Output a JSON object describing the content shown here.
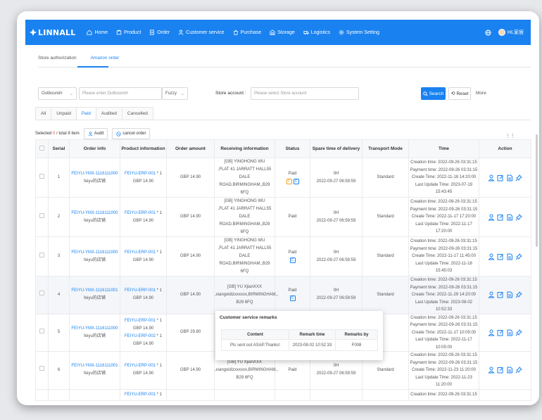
{
  "app": {
    "logo": "LINNALL"
  },
  "nav": [
    {
      "label": "Home",
      "icon": "home-icon"
    },
    {
      "label": "Product",
      "icon": "product-icon"
    },
    {
      "label": "Order",
      "icon": "order-icon"
    },
    {
      "label": "Customer service",
      "icon": "customer-icon"
    },
    {
      "label": "Purchase",
      "icon": "purchase-icon"
    },
    {
      "label": "Storage",
      "icon": "storage-icon"
    },
    {
      "label": "Logistics",
      "icon": "logistics-icon"
    },
    {
      "label": "System Setting",
      "icon": "settings-icon"
    }
  ],
  "user": {
    "name": "HL家居"
  },
  "subtabs": [
    "Store authorization",
    "Amazon order"
  ],
  "filters": {
    "type_select": "Outbound#",
    "keyword_placeholder": "Please enter Outbound#",
    "match_select": "Fuzzy",
    "store_label": "Store account :",
    "store_placeholder": "Please select Store account",
    "search_label": "Search",
    "reset_label": "Reset",
    "more_label": "More"
  },
  "status_tabs": [
    "All",
    "Unpaid",
    "Paid",
    "Audited",
    "Cancelled"
  ],
  "selection": {
    "prefix": "Selected",
    "count": "0",
    "total": "/ total 9 item",
    "audit_label": "Audit",
    "cancel_label": "cancel order"
  },
  "columns": [
    "Serial",
    "Order info",
    "Product information",
    "Order amount",
    "Receiving information",
    "Status",
    "Spare time of delivery",
    "Transport Mode",
    "Time",
    "Action"
  ],
  "rows": [
    {
      "serial": "1",
      "order_id": "FEIYU-YMX-1116111000",
      "store": "feiyu的店铺",
      "products": [
        {
          "sku": "FEIYU-ERP-001",
          "qty": " * 1",
          "price": "GBP 14.90"
        }
      ],
      "amount": "GBP 14.90",
      "recv": [
        "[GB] YINGHONG WU",
        ",FLAT 41 JARRATT HALL55 DALE",
        "ROAD,BIRMINGHAM,,B29 6FQ"
      ],
      "status": "Paid",
      "tags": [
        "F",
        "C"
      ],
      "spare": "0H",
      "spare_date": "2022-09-27 06:59:59",
      "transport": "Standard",
      "times": [
        "Creation time: 2022-09-26 03:31:15",
        "Payment time: 2022-09-26 03:31:15",
        "Create Time: 2022-11-18 14:20:00",
        "Last Update Time: 2023-07-19 15:43:45"
      ]
    },
    {
      "serial": "2",
      "order_id": "FEIYU-YMX-1116111000",
      "store": "feiyu的店铺",
      "products": [
        {
          "sku": "FEIYU-ERP-001",
          "qty": " * 1",
          "price": "GBP 14.90"
        }
      ],
      "amount": "GBP 14.90",
      "recv": [
        "[GB] YINGHONG WU",
        ",FLAT 41 JARRATT HALL55 DALE",
        "ROAD,BIRMINGHAM,,B29 6FQ"
      ],
      "status": "Paid",
      "tags": [],
      "spare": "0H",
      "spare_date": "2022-09-27 06:59:59",
      "transport": "Standard",
      "times": [
        "Creation time: 2022-09-26 03:31:15",
        "Payment time: 2022-09-26 03:31:15",
        "Create Time: 2022-11-17 17:20:00",
        "Last Update Time: 2022-11-17 17:20:00"
      ]
    },
    {
      "serial": "3",
      "order_id": "FEIYU-YMX-1116111000",
      "store": "feiyu的店铺",
      "products": [
        {
          "sku": "FEIYU-ERP-001",
          "qty": " * 1",
          "price": "GBP 14.90"
        }
      ],
      "amount": "GBP 14.90",
      "recv": [
        "[GB] YINGHONG WU",
        ",FLAT 41 JARRATT HALL55 DALE",
        "ROAD,BIRMINGHAM,,B29 6FQ"
      ],
      "status": "Paid",
      "tags": [
        "C"
      ],
      "spare": "0H",
      "spare_date": "2022-09-27 06:59:59",
      "transport": "Standard",
      "times": [
        "Creation time: 2022-09-26 03:31:15",
        "Payment time: 2022-09-26 03:31:15",
        "Create Time: 2022-11-17 11:45:00",
        "Last Update Time: 2022-11-18 15:45:03"
      ]
    },
    {
      "serial": "4",
      "order_id": "FEIYU-YMX-1116111001",
      "store": "feiyu的店铺",
      "products": [
        {
          "sku": "FEIYU-ERP-001",
          "qty": " * 1",
          "price": "GBP 14.90"
        }
      ],
      "amount": "GBP 14.90",
      "recv": [
        "[GB] YU XjianXXX",
        ",xiangxidizxxxxxx,BIRMINGHAM,,",
        "B29 6FQ"
      ],
      "status": "Paid",
      "tags": [
        "C"
      ],
      "spare": "0H",
      "spare_date": "2022-09-27 06:59:59",
      "transport": "Standard",
      "times": [
        "Creation time: 2022-09-26 03:31:15",
        "Payment time: 2022-09-26 03:31:15",
        "Create Time: 2022-11-29 14:20:00",
        "Last Update Time: 2023-08-02 10:52:33"
      ]
    },
    {
      "serial": "5",
      "order_id": "FEIYU-YMX-1116111000",
      "store": "feiyu的店铺",
      "products": [
        {
          "sku": "FEIYU-ERP-001",
          "qty": " * 1",
          "price": "GBP 14.90"
        },
        {
          "sku": "FEIYU-ERP-002",
          "qty": " * 1",
          "price": "GBP 14.90"
        }
      ],
      "amount": "GBP 29.80",
      "recv": [],
      "status": "",
      "tags": [],
      "spare": "",
      "spare_date": "",
      "transport": "",
      "times": [
        "Creation time: 2022-09-26 03:31:15",
        "Payment time: 2022-09-26 03:31:15",
        "Create Time: 2022-11-17 10:05:00",
        "Last Update Time: 2022-11-17 10:05:00"
      ]
    },
    {
      "serial": "6",
      "order_id": "FEIYU-YMX-1116111001",
      "store": "feiyu的店铺",
      "products": [
        {
          "sku": "FEIYU-ERP-001",
          "qty": " * 1",
          "price": "GBP 14.90"
        }
      ],
      "amount": "GBP 14.90",
      "recv": [
        "[GB] YU XjianXXX",
        ",xiangxidizxxxxxx,BIRMINGHAM,,",
        "B29 6FQ"
      ],
      "status": "Paid",
      "tags": [],
      "spare": "0H",
      "spare_date": "2022-09-27 06:59:59",
      "transport": "Standard",
      "times": [
        "Creation time: 2022-09-26 03:31:15",
        "Payment time: 2022-09-26 03:31:15",
        "Create Time: 2022-11-23 11:20:00",
        "Last Update Time: 2022-11-23 11:20:00"
      ]
    },
    {
      "serial": "",
      "order_id": "",
      "store": "",
      "products": [
        {
          "sku": "FEIYU-ERP-001",
          "qty": " * 1",
          "price": ""
        }
      ],
      "amount": "",
      "recv": [],
      "status": "",
      "tags": [],
      "spare": "",
      "spare_date": "",
      "transport": "",
      "times": [
        "Creation time: 2022-09-26 03:31:15"
      ]
    }
  ],
  "popup": {
    "title": "Customer service remarks",
    "headers": [
      "Content",
      "Remark time",
      "Remarks by"
    ],
    "row": [
      "Pls sent out ASAP.Thanks!",
      "2023-08-02 10:52:33",
      "F008"
    ]
  },
  "colors": {
    "primary": "#1a82f0",
    "danger": "#e54545",
    "warn": "#f0a020"
  }
}
